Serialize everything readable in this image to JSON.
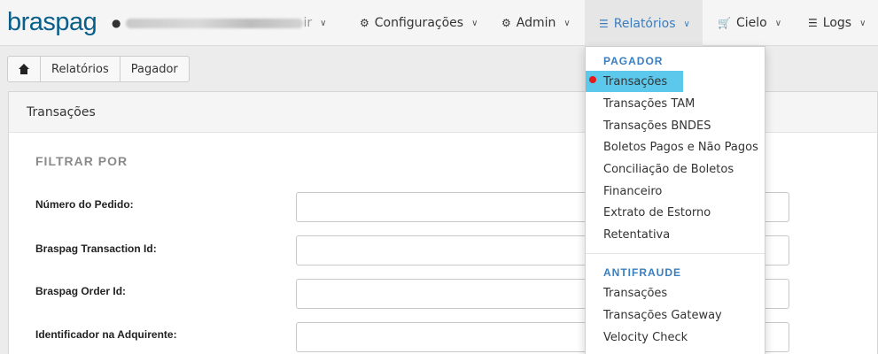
{
  "navbar": {
    "logo": "braspag",
    "user_suffix": "ir",
    "items": [
      {
        "label": "Configurações",
        "icon": "gear-icon"
      },
      {
        "label": "Admin",
        "icon": "gear-icon"
      },
      {
        "label": "Relatórios",
        "icon": "list-icon"
      },
      {
        "label": "Cielo",
        "icon": "cart-icon"
      },
      {
        "label": "Logs",
        "icon": "database-icon"
      }
    ],
    "active_color": "#3a7ebf"
  },
  "breadcrumb": [
    "Relatórios",
    "Pagador"
  ],
  "panel": {
    "title": "Transações",
    "filter_title": "FILTRAR POR",
    "fields": [
      {
        "label": "Número do Pedido:",
        "value": ""
      },
      {
        "label": "Braspag Transaction Id:",
        "value": ""
      },
      {
        "label": "Braspag Order Id:",
        "value": ""
      },
      {
        "label": "Identificador na Adquirente:",
        "value": ""
      }
    ]
  },
  "dropdown": {
    "section1_header": "PAGADOR",
    "section1_items": [
      "Transações",
      "Transações TAM",
      "Transações BNDES",
      "Boletos Pagos e Não Pagos",
      "Conciliação de Boletos",
      "Financeiro",
      "Extrato de Estorno",
      "Retentativa"
    ],
    "section2_header": "ANTIFRAUDE",
    "section2_items": [
      "Transações",
      "Transações Gateway",
      "Velocity Check"
    ],
    "highlight_color": "#5bc8ec"
  }
}
